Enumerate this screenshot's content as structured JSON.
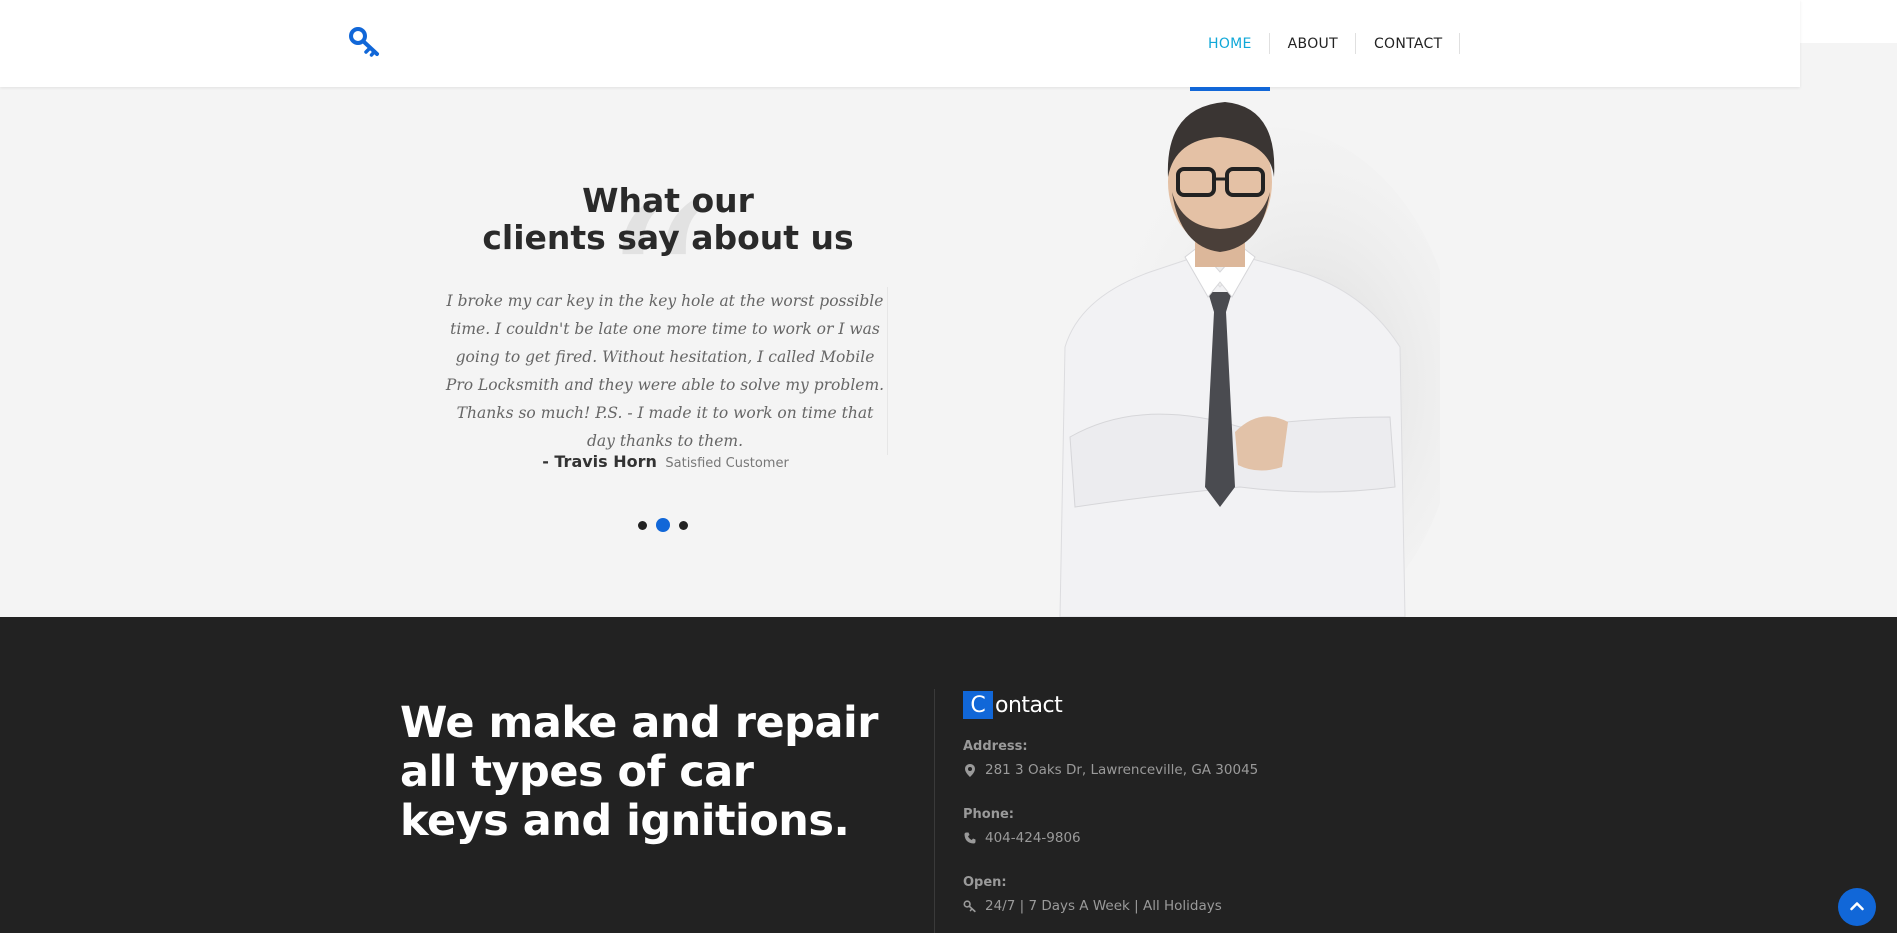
{
  "header": {
    "logo_icon": "key-icon",
    "nav": [
      {
        "label": "HOME",
        "active": true
      },
      {
        "label": "ABOUT",
        "active": false
      },
      {
        "label": "CONTACT",
        "active": false
      }
    ]
  },
  "testimonial": {
    "title_line1": "What our",
    "title_line2": "clients say about us",
    "quote": "I broke my car key in the key hole at the worst possible time. I couldn't be late one more time to work or I was going to get fired. Without hesitation, I called Mobile Pro Locksmith and they were able to solve my problem. Thanks so much! P.S. - I made it to work on time that day thanks to them.",
    "author_name": "- Travis Horn",
    "author_role": "Satisfied Customer",
    "slides": 3,
    "active_slide": 2
  },
  "footer": {
    "tagline_line1": "We make and repair",
    "tagline_line2": "all types of car",
    "tagline_line3": "keys and ignitions.",
    "contact_initial": "C",
    "contact_rest": "ontact",
    "address_label": "Address:",
    "address_value": "281 3 Oaks Dr, Lawrenceville, GA 30045",
    "phone_label": "Phone:",
    "phone_value": "404-424-9806",
    "open_label": "Open:",
    "open_value": "24/7 | 7 Days A Week | All Holidays"
  },
  "colors": {
    "accent": "#1167d8",
    "active_nav": "#11a8d8",
    "footer_bg": "#222222"
  }
}
